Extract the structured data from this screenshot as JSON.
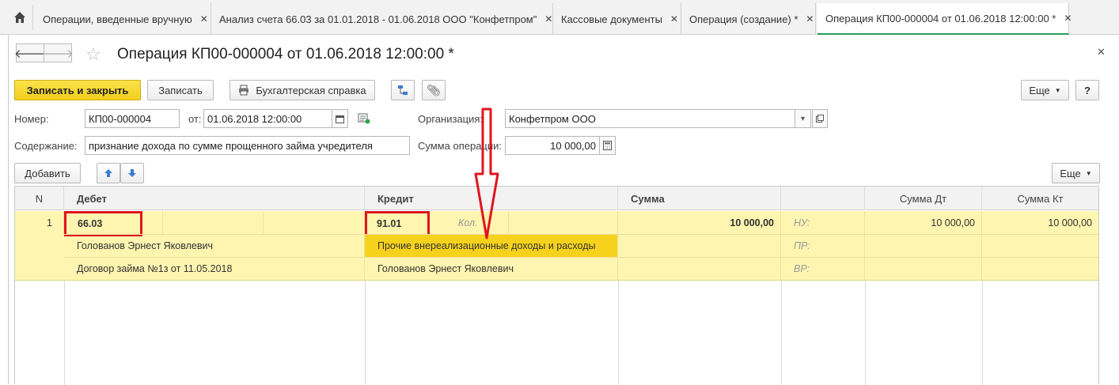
{
  "tabs": [
    {
      "label": "Операции, введенные вручную"
    },
    {
      "label": "Анализ счета 66.03 за 01.01.2018 - 01.06.2018 ООО \"Конфетпром\""
    },
    {
      "label": "Кассовые документы"
    },
    {
      "label": "Операция (создание) *"
    },
    {
      "label": "Операция КП00-000004 от 01.06.2018 12:00:00 *"
    }
  ],
  "form": {
    "title": "Операция КП00-000004 от 01.06.2018 12:00:00 *",
    "toolbar": {
      "save_close": "Записать и закрыть",
      "save": "Записать",
      "reference": "Бухгалтерская справка",
      "more": "Еще",
      "help": "?"
    },
    "fields": {
      "number_label": "Номер:",
      "number_value": "КП00-000004",
      "date_label": "от:",
      "date_value": "01.06.2018 12:00:00",
      "org_label": "Организация:",
      "org_value": "Конфетпром ООО",
      "content_label": "Содержание:",
      "content_value": "признание дохода по сумме прощенного займа учредителя",
      "sum_label": "Сумма операции:",
      "sum_value": "10 000,00"
    },
    "table_toolbar": {
      "add": "Добавить",
      "more": "Еще"
    },
    "table": {
      "headers": {
        "n": "N",
        "debit": "Дебет",
        "credit": "Кредит",
        "sum": "Сумма",
        "sum_dt": "Сумма Дт",
        "sum_kt": "Сумма Кт"
      },
      "row": {
        "n": "1",
        "debit_account": "66.03",
        "debit_sub1": "Голованов Эрнест Яковлевич",
        "debit_sub2": "Договор займа №1з от 11.05.2018",
        "credit_account": "91.01",
        "credit_qty_hint": "Кол.",
        "credit_sub1": "Прочие внереализационные доходы и расходы",
        "credit_sub2": "Голованов Эрнест Яковлевич",
        "sum": "10 000,00",
        "nu": "НУ:",
        "pr": "ПР:",
        "vr": "ВР:",
        "sum_dt": "10 000,00",
        "sum_kt": "10 000,00"
      }
    }
  },
  "colors": {
    "primary_button": "#f2cf1e",
    "row_highlight": "#fdf5b0",
    "selected_cell": "#f7d21c",
    "annotation_red": "#e0141e",
    "active_tab_accent": "#2a9d5c"
  },
  "icons": [
    "home-icon",
    "close-icon",
    "arrow-left-icon",
    "arrow-right-icon",
    "star-icon",
    "printer-icon",
    "structure-icon",
    "paperclip-icon",
    "calendar-icon",
    "calculator-icon",
    "dropdown-icon",
    "open-icon",
    "arrow-up-icon",
    "arrow-down-icon"
  ]
}
